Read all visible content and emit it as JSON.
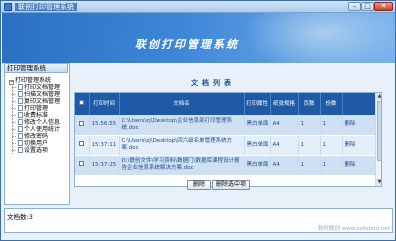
{
  "window": {
    "title": "联创打印管理系统",
    "controls": {
      "minimize": "–",
      "maximize": "□",
      "close": "✕"
    }
  },
  "banner": {
    "title": "联创打印管理系统"
  },
  "sidebar": {
    "header": "打印管理系统",
    "root": "打印管理系统",
    "root_toggle": "−",
    "items": [
      {
        "label": "打印文档管理"
      },
      {
        "label": "扫描文档管理"
      },
      {
        "label": "复印文档管理"
      },
      {
        "label": "打印管理"
      },
      {
        "label": "收费标准"
      },
      {
        "label": "修改个人信息"
      },
      {
        "label": "个人使用统计"
      },
      {
        "label": "修改密码"
      },
      {
        "label": "切换用户"
      },
      {
        "label": "设置选项"
      }
    ]
  },
  "main": {
    "list_title": "文档列表",
    "columns": [
      "",
      "打印时间",
      "文档名",
      "打印属性",
      "纸张规格",
      "页数",
      "份数",
      ""
    ],
    "rows": [
      {
        "time": "15:56:55",
        "name": "C:\\Users\\zj\\Desktop\\企业信息部打印管理系统.doc",
        "attr": "黑白单面",
        "paper": "A4",
        "pages": "1",
        "copies": "1",
        "action": "删除"
      },
      {
        "time": "15:37:11",
        "name": "C:\\Users\\zj\\Desktop\\四六级名单管理系统方案.doc",
        "attr": "黑白单面",
        "paper": "A4",
        "pages": "1",
        "copies": "1",
        "action": "删除"
      },
      {
        "time": "15:37:25",
        "name": "D:\\联创文件\\学习资料\\数据门\\数据库课程设计报告企业信息系统解决方案.doc",
        "attr": "黑白单面",
        "paper": "A4",
        "pages": "1",
        "copies": "1",
        "action": "删除"
      }
    ],
    "buttons": {
      "delete": "删除",
      "delete_selected": "删除选中项"
    }
  },
  "status": {
    "text": "文档数:3"
  },
  "watermark": "软件联创 www.ssileond.net",
  "colors": {
    "accent": "#1f5aa6",
    "banner": "#2a6fc2"
  }
}
